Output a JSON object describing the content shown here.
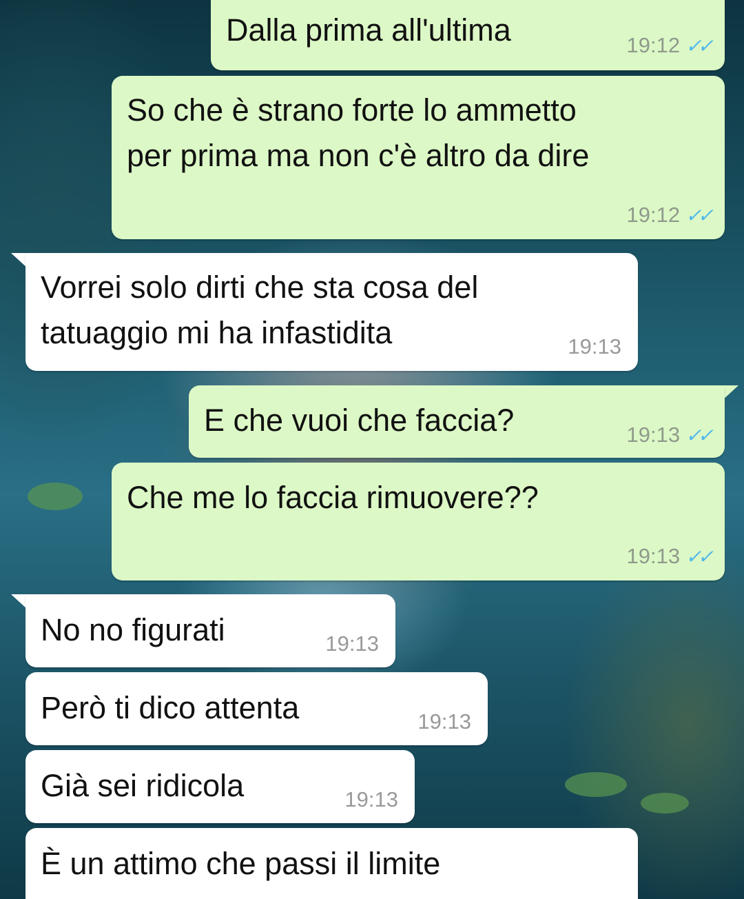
{
  "messages": [
    {
      "text": "Dalla prima all'ultima",
      "time": "19:12",
      "status": "read"
    },
    {
      "text_line1": "So che è strano forte lo ammetto",
      "text_line2": "per prima ma non c'è altro da dire",
      "time": "19:12",
      "status": "read"
    },
    {
      "text_line1": "Vorrei solo dirti che sta cosa del",
      "text_line2": "tatuaggio mi ha infastidita",
      "time": "19:13"
    },
    {
      "text": "E che vuoi che faccia?",
      "time": "19:13",
      "status": "read"
    },
    {
      "text": "Che me lo faccia rimuovere??",
      "time": "19:13",
      "status": "read"
    },
    {
      "text": "No no figurati",
      "time": "19:13"
    },
    {
      "text": "Però ti dico attenta",
      "time": "19:13"
    },
    {
      "text": "Già sei ridicola",
      "time": "19:13"
    },
    {
      "text": "È un attimo che passi il limite"
    }
  ],
  "icons": {
    "read_receipt": "double-check-icon",
    "read_receipt_color": "#4fb6ec"
  },
  "colors": {
    "outgoing_bubble": "#dcf8c6",
    "incoming_bubble": "#ffffff"
  }
}
